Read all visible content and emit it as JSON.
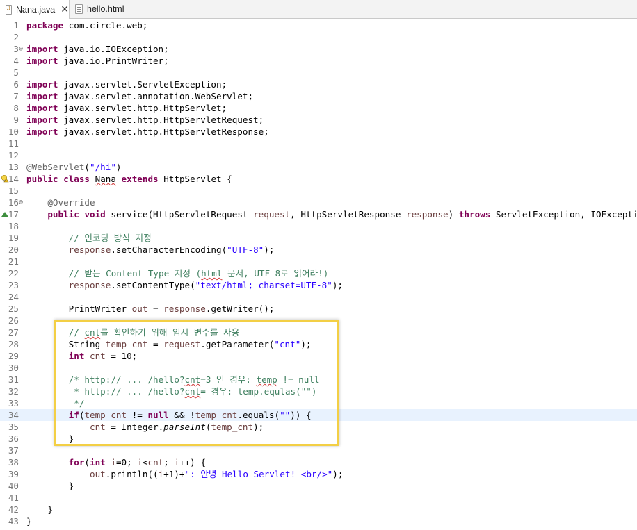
{
  "tabs": [
    {
      "label": "Nana.java",
      "active": true,
      "icon": "java-file-icon",
      "close": "✕"
    },
    {
      "label": "hello.html",
      "active": false,
      "icon": "html-file-icon"
    }
  ],
  "lines": [
    {
      "n": "1",
      "html": "<span class='kw'>package</span> com.circle.web;"
    },
    {
      "n": "2",
      "html": ""
    },
    {
      "n": "3",
      "fold": true,
      "html": "<span class='kw'>import</span> java.io.IOException;"
    },
    {
      "n": "4",
      "html": "<span class='kw'>import</span> java.io.PrintWriter;"
    },
    {
      "n": "5",
      "html": ""
    },
    {
      "n": "6",
      "html": "<span class='kw'>import</span> javax.servlet.ServletException;"
    },
    {
      "n": "7",
      "html": "<span class='kw'>import</span> javax.servlet.annotation.WebServlet;"
    },
    {
      "n": "8",
      "html": "<span class='kw'>import</span> javax.servlet.http.HttpServlet;"
    },
    {
      "n": "9",
      "html": "<span class='kw'>import</span> javax.servlet.http.HttpServletRequest;"
    },
    {
      "n": "10",
      "html": "<span class='kw'>import</span> javax.servlet.http.HttpServletResponse;"
    },
    {
      "n": "11",
      "html": ""
    },
    {
      "n": "12",
      "html": ""
    },
    {
      "n": "13",
      "html": "<span class='ann'>@WebServlet</span>(<span class='str'>\"/hi\"</span>)"
    },
    {
      "n": "14",
      "bulb": true,
      "html": "<span class='kw'>public</span> <span class='kw'>class</span> <span class='squig'>Nana</span> <span class='kw'>extends</span> HttpServlet {"
    },
    {
      "n": "15",
      "html": ""
    },
    {
      "n": "16",
      "fold": true,
      "html": "    <span class='ann'>@Override</span>"
    },
    {
      "n": "17",
      "override": true,
      "html": "    <span class='kw'>public</span> <span class='kw'>void</span> service(HttpServletRequest <span class='var'>request</span>, HttpServletResponse <span class='var'>response</span>) <span class='kw'>throws</span> ServletException, IOException {"
    },
    {
      "n": "18",
      "html": ""
    },
    {
      "n": "19",
      "html": "        <span class='cmt'>// 인코딩 방식 지정</span>"
    },
    {
      "n": "20",
      "html": "        <span class='var'>response</span>.setCharacterEncoding(<span class='str'>\"UTF-8\"</span>);"
    },
    {
      "n": "21",
      "html": ""
    },
    {
      "n": "22",
      "html": "        <span class='cmt'>// 받는 Content Type 지정 (<span class='squig'>html</span> 문서, UTF-8로 읽어라!)</span>"
    },
    {
      "n": "23",
      "html": "        <span class='var'>response</span>.setContentType(<span class='str'>\"text/html; charset=UTF-8\"</span>);"
    },
    {
      "n": "24",
      "html": ""
    },
    {
      "n": "25",
      "html": "        PrintWriter <span class='var'>out</span> = <span class='var'>response</span>.getWriter();"
    },
    {
      "n": "26",
      "html": ""
    },
    {
      "n": "27",
      "html": "        <span class='cmt'>// <span class='squig'>cnt</span>를 확인하기 위해 임시 변수를 사용</span>"
    },
    {
      "n": "28",
      "html": "        String <span class='var'>temp_cnt</span> = <span class='var'>request</span>.getParameter(<span class='str'>\"cnt\"</span>);"
    },
    {
      "n": "29",
      "html": "        <span class='kw'>int</span> <span class='var'>cnt</span> = 10;"
    },
    {
      "n": "30",
      "html": ""
    },
    {
      "n": "31",
      "html": "        <span class='cmt'>/* http:// ... /hello?<span class='squig'>cnt</span>=3 인 경우: <span class='squig'>temp</span> != null</span>"
    },
    {
      "n": "32",
      "html": "<span class='cmt'>         * http:// ... /hello?<span class='squig'>cnt</span>= 경우: temp.equlas(\"\")</span>"
    },
    {
      "n": "33",
      "html": "<span class='cmt'>         */</span>"
    },
    {
      "n": "34",
      "highlight": true,
      "html": "        <span class='kw'>if</span>(<span class='var'>temp_cnt</span> != <span class='kw'>null</span> &amp;&amp; !<span class='var'>temp_cnt</span>.equals(<span class='str'>\"\"</span>)) {"
    },
    {
      "n": "35",
      "html": "            <span class='var'>cnt</span> = Integer.<span class='ital'>parseInt</span>(<span class='var'>temp_cnt</span>);"
    },
    {
      "n": "36",
      "html": "        }"
    },
    {
      "n": "37",
      "html": ""
    },
    {
      "n": "38",
      "html": "        <span class='kw'>for</span>(<span class='kw'>int</span> <span class='var'>i</span>=0; <span class='var'>i</span>&lt;<span class='var'>cnt</span>; <span class='var'>i</span>++) {"
    },
    {
      "n": "39",
      "html": "            <span class='var'>out</span>.println((<span class='var'>i</span>+1)+<span class='str'>\": 안녕 Hello Servlet! &lt;br/&gt;\"</span>);"
    },
    {
      "n": "40",
      "html": "        }"
    },
    {
      "n": "41",
      "html": ""
    },
    {
      "n": "42",
      "html": "    }"
    },
    {
      "n": "43",
      "html": "}"
    }
  ],
  "colors": {
    "keyword": "#7f0055",
    "string": "#2a00ff",
    "comment": "#3f7f5f",
    "annotation_box": "#f3cf45"
  }
}
